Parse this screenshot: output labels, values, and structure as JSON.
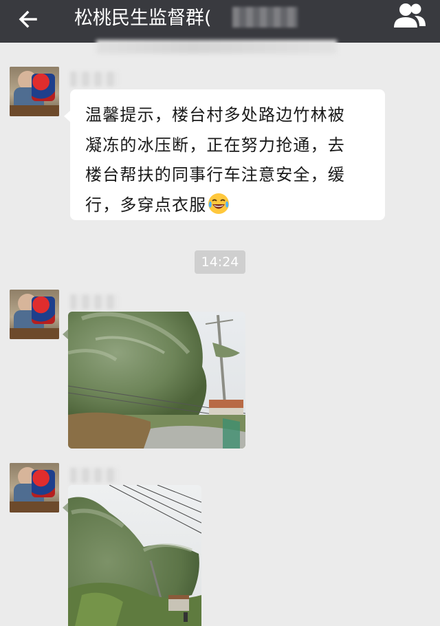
{
  "header": {
    "title": "松桃民生监督群(",
    "back_icon": "back-arrow-icon",
    "group_icon": "group-members-icon"
  },
  "messages": [
    {
      "type": "text",
      "text_line1": "温馨提示，楼台村多处路边竹林被",
      "text_line2": "凝冻的冰压断，正在努力抢通，去",
      "text_line3": "楼台帮扶的同事行车注意安全，缓",
      "text_line4": "行，多穿点衣服",
      "emoji": "laughing-tears-emoji"
    },
    {
      "type": "timestamp",
      "time": "14:24"
    },
    {
      "type": "image",
      "description_icon": "photo-bamboo-roadside"
    },
    {
      "type": "image",
      "description_icon": "photo-bamboo-powerline"
    }
  ],
  "colors": {
    "header_bg": "#393a3f",
    "chat_bg": "#ebebeb",
    "bubble_bg": "#ffffff",
    "timestamp_bg": "#cfcfcf"
  }
}
